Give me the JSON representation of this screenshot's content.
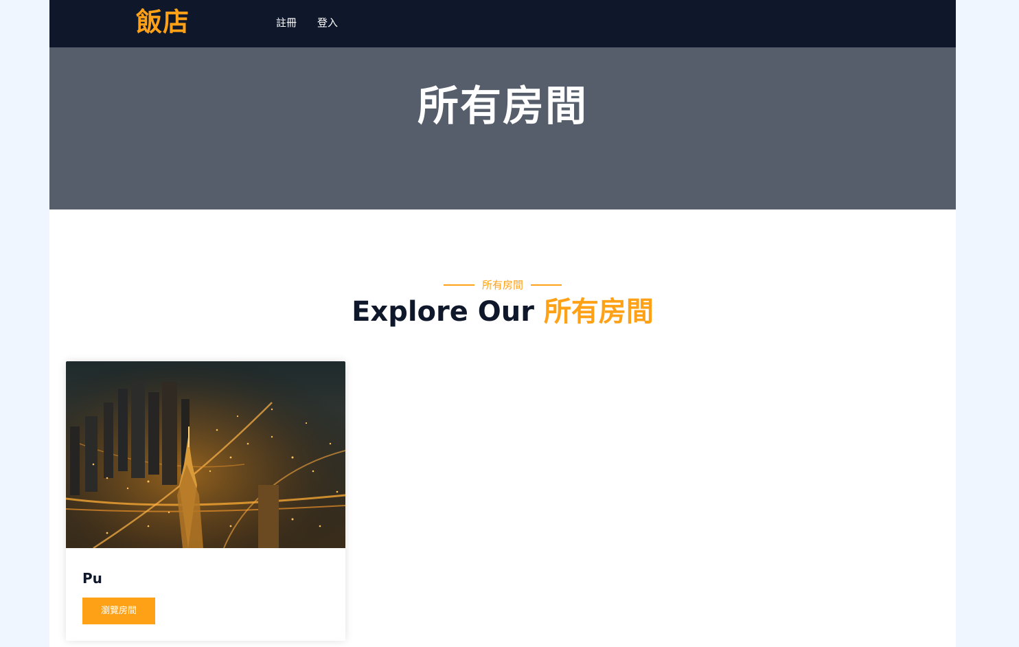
{
  "navbar": {
    "brand": "飯店",
    "links": [
      {
        "label": "註冊"
      },
      {
        "label": "登入"
      }
    ]
  },
  "hero": {
    "title": "所有房間"
  },
  "section": {
    "subtitle": "所有房間",
    "title_prefix": "Explore Our",
    "title_accent": "所有房間"
  },
  "rooms": [
    {
      "name": "Pu",
      "button_label": "瀏覽房間",
      "image_icon": "city-night-skyline-photo"
    }
  ],
  "colors": {
    "accent": "#fea116",
    "navbar": "#0f172b",
    "hero": "#565d6b",
    "page_background": "#f0f6ff"
  }
}
